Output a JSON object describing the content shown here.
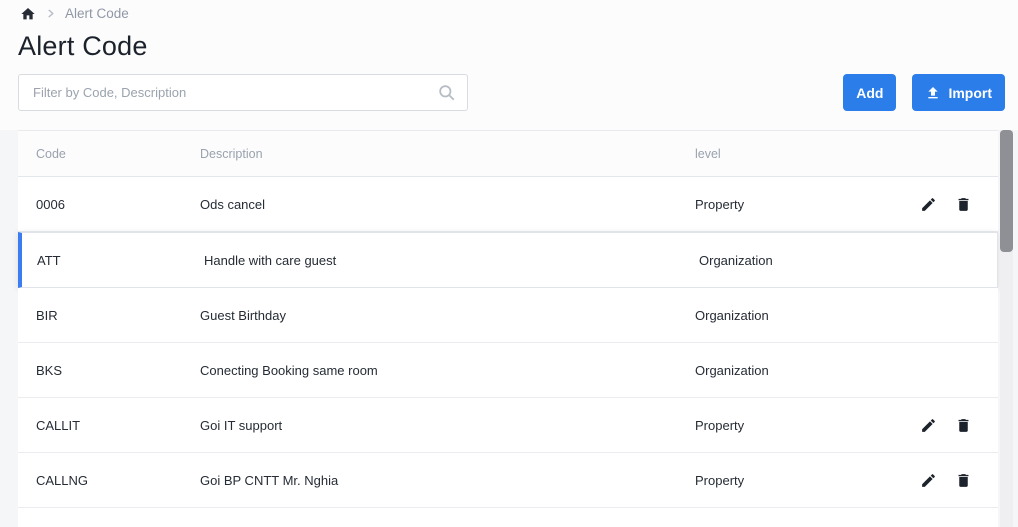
{
  "breadcrumb": {
    "items": [
      {
        "label": "Alert Code"
      }
    ]
  },
  "page": {
    "title": "Alert Code"
  },
  "toolbar": {
    "filter": {
      "placeholder": "Filter by Code, Description",
      "value": ""
    },
    "add_button": "Add",
    "import_button": "Import"
  },
  "table": {
    "headers": {
      "code": "Code",
      "description": "Description",
      "level": "level"
    },
    "rows": [
      {
        "code": "0006",
        "description": "Ods cancel",
        "level": "Property",
        "has_actions": true,
        "selected": false
      },
      {
        "code": "ATT",
        "description": "Handle with care guest",
        "level": "Organization",
        "has_actions": false,
        "selected": true
      },
      {
        "code": "BIR",
        "description": "Guest Birthday",
        "level": "Organization",
        "has_actions": false,
        "selected": false
      },
      {
        "code": "BKS",
        "description": "Conecting Booking same room",
        "level": "Organization",
        "has_actions": false,
        "selected": false
      },
      {
        "code": "CALLIT",
        "description": "Goi IT support",
        "level": "Property",
        "has_actions": true,
        "selected": false
      },
      {
        "code": "CALLNG",
        "description": "Goi BP CNTT Mr. Nghia",
        "level": "Property",
        "has_actions": true,
        "selected": false
      }
    ]
  },
  "icons": {
    "home": "home-icon",
    "separator": "chevron-right-icon",
    "search": "search-icon",
    "import": "upload-icon",
    "edit": "pencil-icon",
    "delete": "trash-icon"
  },
  "colors": {
    "accent_blue": "#2b7de9",
    "selected_row_border": "#3b7df0",
    "row_text": "#262c35",
    "muted_text": "#98a1ad",
    "scrollbar_thumb": "#8e9095"
  }
}
